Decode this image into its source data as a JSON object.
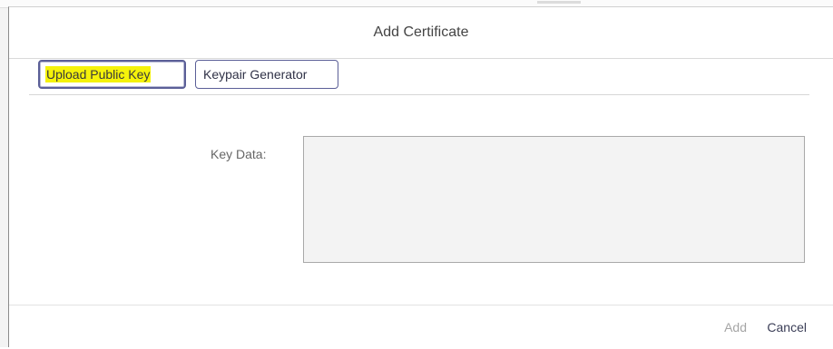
{
  "dialog": {
    "title": "Add Certificate",
    "tabs": [
      {
        "label": "Upload Public Key",
        "selected": true
      },
      {
        "label": "Keypair Generator",
        "selected": false
      }
    ],
    "form": {
      "key_data_label": "Key Data:",
      "key_data_value": ""
    },
    "footer": {
      "add_label": "Add",
      "add_enabled": false,
      "cancel_label": "Cancel"
    }
  },
  "colors": {
    "highlight": "#f5f20a",
    "tab_border": "#5b5f97",
    "textarea_bg": "#f3f3f3"
  }
}
